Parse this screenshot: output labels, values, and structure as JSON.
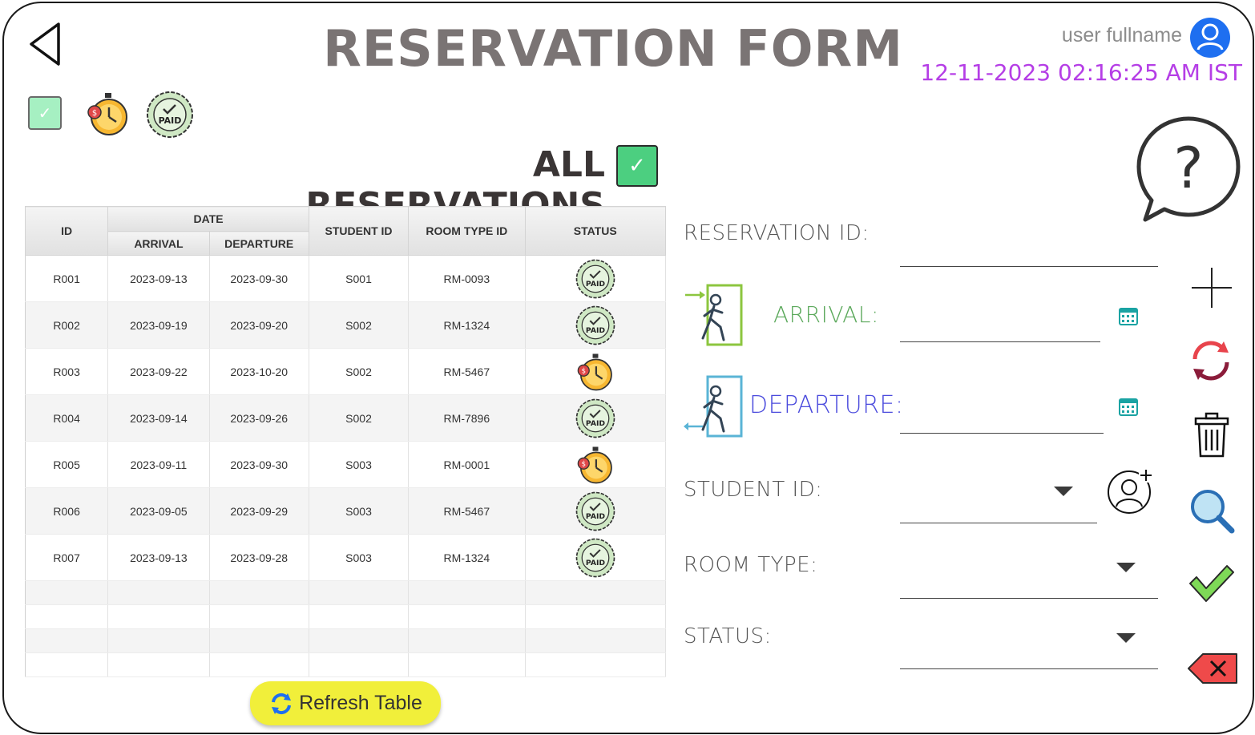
{
  "header": {
    "title": "RESERVATION FORM",
    "user_fullname": "user fullname",
    "datetime": "12-11-2023 02:16:25 AM IST"
  },
  "legend": {
    "check_icon": "checkbox-icon",
    "pending_icon": "stopwatch-icon",
    "paid_icon": "paid-badge-icon"
  },
  "section": {
    "title": "ALL RESERVATIONS"
  },
  "table": {
    "headers": {
      "id": "ID",
      "date": "DATE",
      "arrival": "ARRIVAL",
      "departure": "DEPARTURE",
      "student_id": "STUDENT ID",
      "room_type_id": "ROOM TYPE ID",
      "status": "STATUS"
    },
    "rows": [
      {
        "id": "R001",
        "arrival": "2023-09-13",
        "departure": "2023-09-30",
        "student_id": "S001",
        "room_type_id": "RM-0093",
        "status": "paid"
      },
      {
        "id": "R002",
        "arrival": "2023-09-19",
        "departure": "2023-09-20",
        "student_id": "S002",
        "room_type_id": "RM-1324",
        "status": "paid"
      },
      {
        "id": "R003",
        "arrival": "2023-09-22",
        "departure": "2023-10-20",
        "student_id": "S002",
        "room_type_id": "RM-5467",
        "status": "pending"
      },
      {
        "id": "R004",
        "arrival": "2023-09-14",
        "departure": "2023-09-26",
        "student_id": "S002",
        "room_type_id": "RM-7896",
        "status": "paid"
      },
      {
        "id": "R005",
        "arrival": "2023-09-11",
        "departure": "2023-09-30",
        "student_id": "S003",
        "room_type_id": "RM-0001",
        "status": "pending"
      },
      {
        "id": "R006",
        "arrival": "2023-09-05",
        "departure": "2023-09-29",
        "student_id": "S003",
        "room_type_id": "RM-5467",
        "status": "paid"
      },
      {
        "id": "R007",
        "arrival": "2023-09-13",
        "departure": "2023-09-28",
        "student_id": "S003",
        "room_type_id": "RM-1324",
        "status": "paid"
      }
    ]
  },
  "refresh_button": {
    "label": "Refresh Table"
  },
  "form": {
    "reservation_id_label": "RESERVATION ID:",
    "arrival_label": "ARRIVAL:",
    "departure_label": "DEPARTURE:",
    "student_id_label": "STUDENT ID:",
    "room_type_label": "ROOM TYPE:",
    "status_label": "STATUS:",
    "reservation_id_value": "",
    "arrival_value": "",
    "departure_value": "",
    "student_id_value": "",
    "room_type_value": "",
    "status_value": ""
  },
  "colors": {
    "title": "#7a7474",
    "datetime": "#b53ee6",
    "arrival": "#5aa85a",
    "departure": "#4b4bdd",
    "refresh_button": "#f1ef3a",
    "check_green": "#4ccf80"
  }
}
